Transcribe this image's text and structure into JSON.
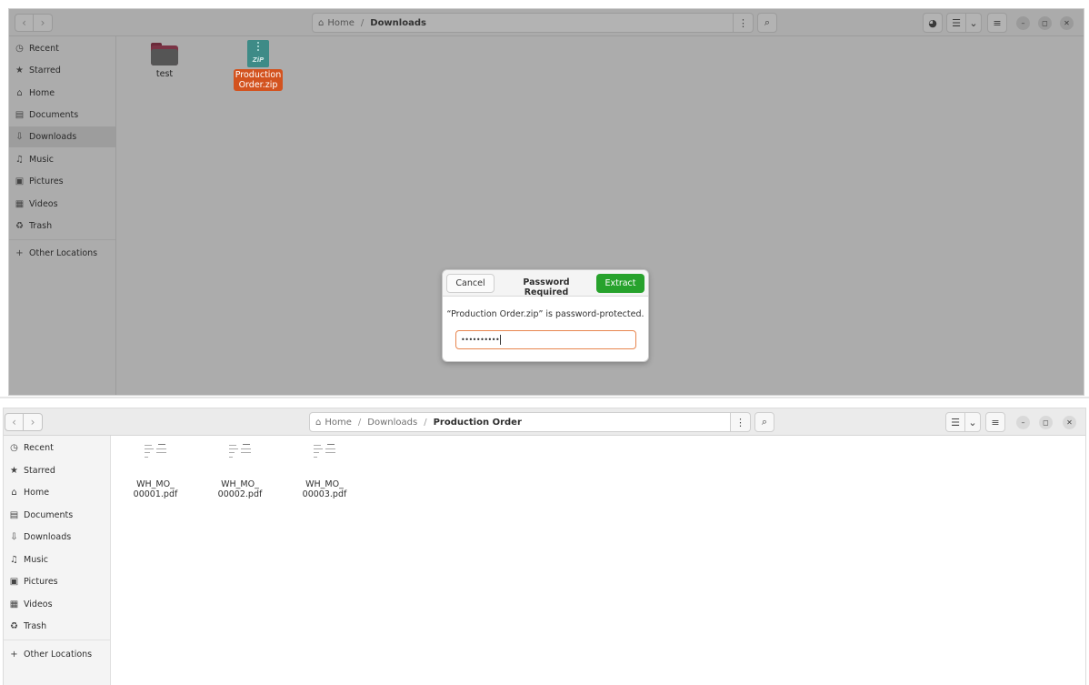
{
  "window1": {
    "breadcrumb": [
      {
        "label": "Home"
      },
      {
        "label": "Downloads"
      }
    ],
    "sidebar": {
      "items": [
        {
          "label": "Recent",
          "icon": "clock-icon",
          "glyph": "◷"
        },
        {
          "label": "Starred",
          "icon": "star-icon",
          "glyph": "★"
        },
        {
          "label": "Home",
          "icon": "home-icon",
          "glyph": "⌂"
        },
        {
          "label": "Documents",
          "icon": "document-icon",
          "glyph": "▤"
        },
        {
          "label": "Downloads",
          "icon": "download-icon",
          "glyph": "⇩",
          "active": true
        },
        {
          "label": "Music",
          "icon": "music-icon",
          "glyph": "♫"
        },
        {
          "label": "Pictures",
          "icon": "picture-icon",
          "glyph": "▣"
        },
        {
          "label": "Videos",
          "icon": "video-icon",
          "glyph": "▦"
        },
        {
          "label": "Trash",
          "icon": "trash-icon",
          "glyph": "♻"
        }
      ],
      "other_locations": {
        "label": "Other Locations",
        "icon": "plus-icon",
        "glyph": "+"
      }
    },
    "files": [
      {
        "name": "test",
        "type": "folder"
      },
      {
        "name": "Production Order.zip",
        "type": "zip",
        "line1": "Production",
        "line2": "Order.zip",
        "selected": true,
        "badge": "ZiP"
      }
    ],
    "dialog": {
      "cancel_label": "Cancel",
      "title": "Password Required",
      "extract_label": "Extract",
      "message": "“Production Order.zip” is password-protected.",
      "password_masked": "••••••••••"
    }
  },
  "window2": {
    "breadcrumb": [
      {
        "label": "Home"
      },
      {
        "label": "Downloads"
      },
      {
        "label": "Production Order"
      }
    ],
    "sidebar": {
      "items": [
        {
          "label": "Recent",
          "icon": "clock-icon",
          "glyph": "◷"
        },
        {
          "label": "Starred",
          "icon": "star-icon",
          "glyph": "★"
        },
        {
          "label": "Home",
          "icon": "home-icon",
          "glyph": "⌂"
        },
        {
          "label": "Documents",
          "icon": "document-icon",
          "glyph": "▤"
        },
        {
          "label": "Downloads",
          "icon": "download-icon",
          "glyph": "⇩"
        },
        {
          "label": "Music",
          "icon": "music-icon",
          "glyph": "♫"
        },
        {
          "label": "Pictures",
          "icon": "picture-icon",
          "glyph": "▣"
        },
        {
          "label": "Videos",
          "icon": "video-icon",
          "glyph": "▦"
        },
        {
          "label": "Trash",
          "icon": "trash-icon",
          "glyph": "♻"
        }
      ],
      "other_locations": {
        "label": "Other Locations",
        "icon": "plus-icon",
        "glyph": "+"
      }
    },
    "files": [
      {
        "name": "WH_MO_00001.pdf",
        "line1": "WH_MO_",
        "line2": "00001.pdf"
      },
      {
        "name": "WH_MO_00002.pdf",
        "line1": "WH_MO_",
        "line2": "00002.pdf"
      },
      {
        "name": "WH_MO_00003.pdf",
        "line1": "WH_MO_",
        "line2": "00003.pdf"
      }
    ]
  },
  "colors": {
    "accent_selection": "#d3531f",
    "extract_button": "#27a22c",
    "input_focus": "#e8864f"
  }
}
